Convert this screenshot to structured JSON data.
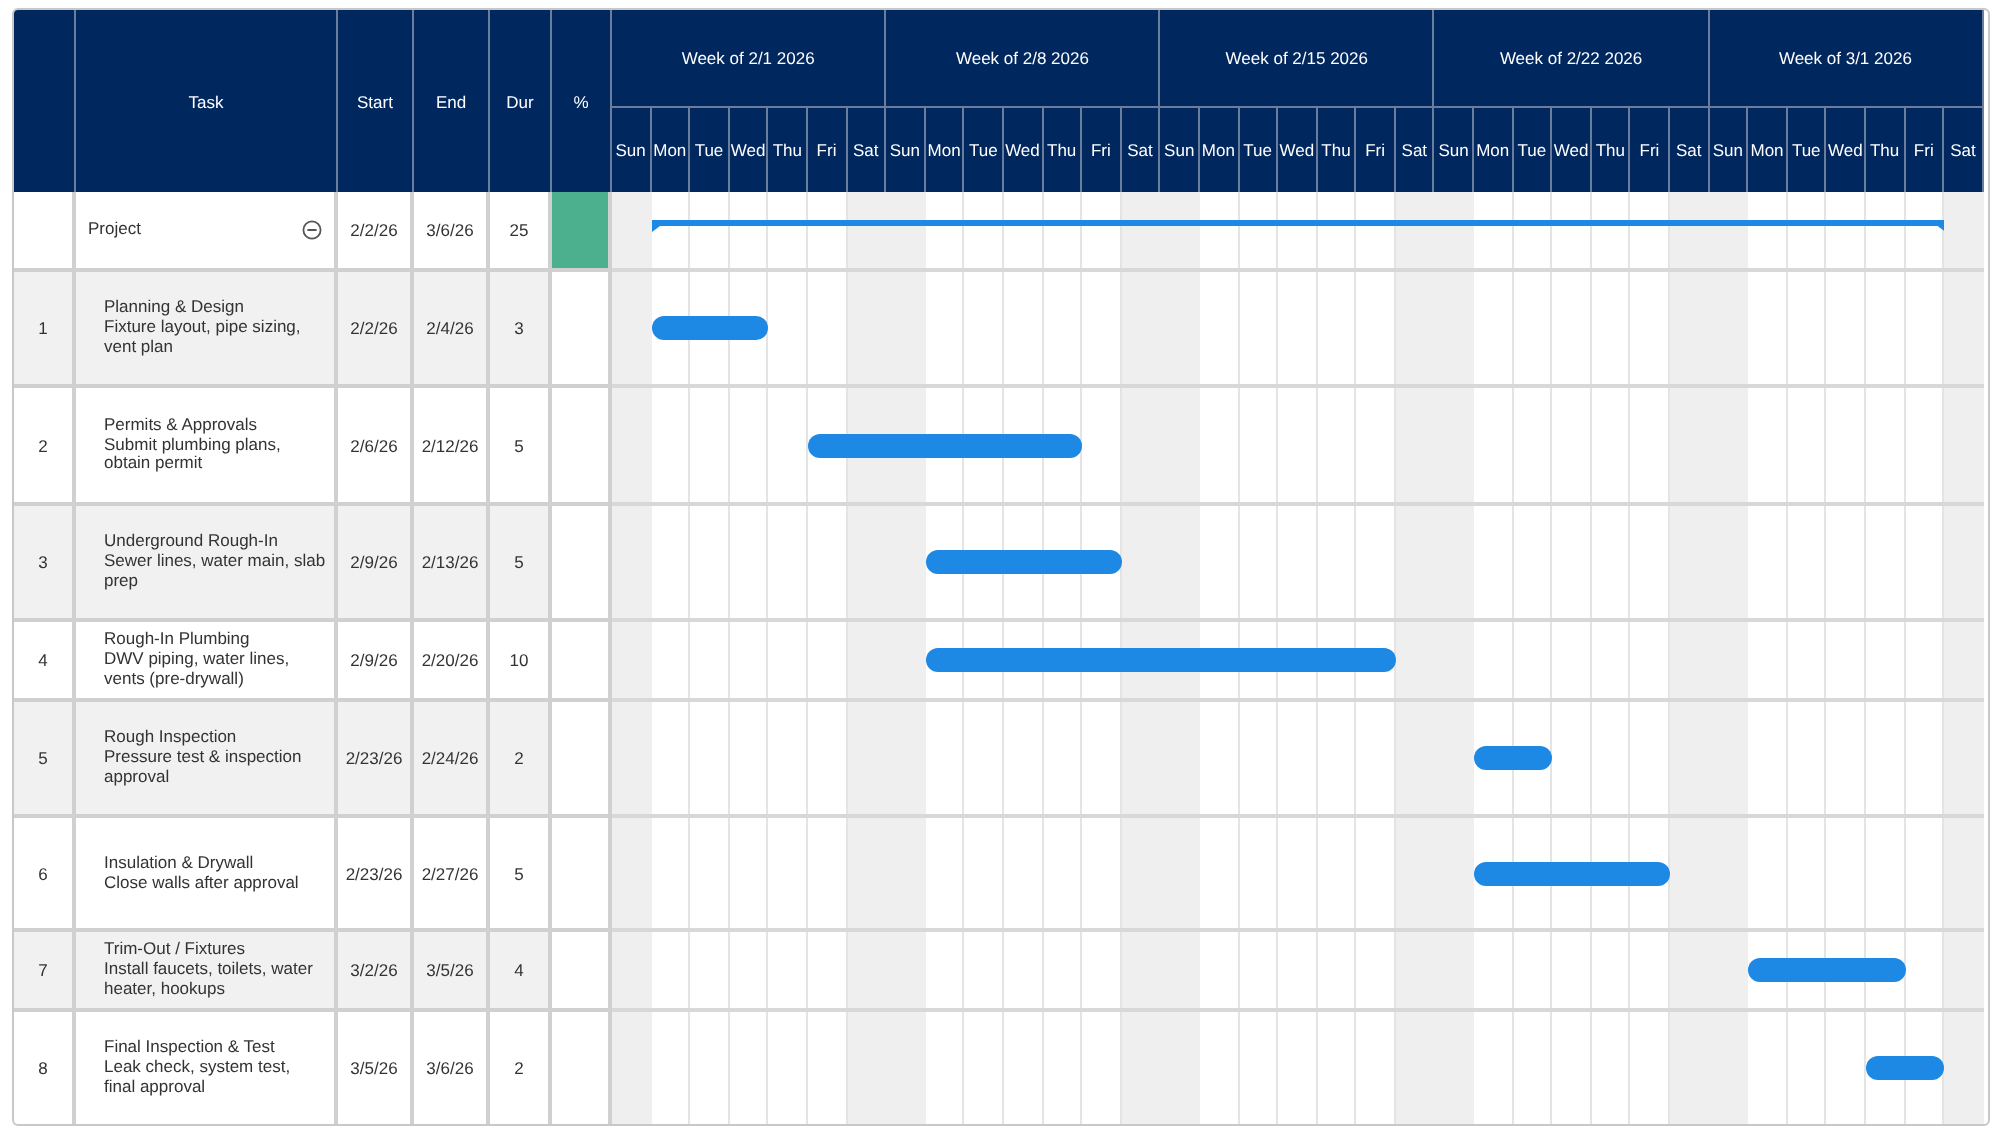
{
  "columns": {
    "task": "Task",
    "start": "Start",
    "end": "End",
    "duration": "Dur",
    "percent": "%"
  },
  "weeks": [
    {
      "label": "Week of 2/1 2026",
      "days": [
        "Sun",
        "Mon",
        "Tue",
        "Wed",
        "Thu",
        "Fri",
        "Sat"
      ]
    },
    {
      "label": "Week of 2/8 2026",
      "days": [
        "Sun",
        "Mon",
        "Tue",
        "Wed",
        "Thu",
        "Fri",
        "Sat"
      ]
    },
    {
      "label": "Week of 2/15 2026",
      "days": [
        "Sun",
        "Mon",
        "Tue",
        "Wed",
        "Thu",
        "Fri",
        "Sat"
      ]
    },
    {
      "label": "Week of 2/22 2026",
      "days": [
        "Sun",
        "Mon",
        "Tue",
        "Wed",
        "Thu",
        "Fri",
        "Sat"
      ]
    },
    {
      "label": "Week of 3/1 2026",
      "days": [
        "Sun",
        "Mon",
        "Tue",
        "Wed",
        "Thu",
        "Fri",
        "Sat"
      ]
    }
  ],
  "project": {
    "name": "Project",
    "expanded": true,
    "start": "2/2/26",
    "end": "3/6/26",
    "duration": "25",
    "percent_highlight": true,
    "children": [
      {
        "number": "1",
        "name": "Planning & Design",
        "description": "Fixture layout, pipe sizing, vent plan",
        "start": "2/2/26",
        "end": "2/4/26",
        "duration": "3",
        "percent_highlight": false
      },
      {
        "number": "2",
        "name": "Permits & Approvals",
        "description": "Submit plumbing plans, obtain permit",
        "start": "2/6/26",
        "end": "2/12/26",
        "duration": "5",
        "percent_highlight": false
      },
      {
        "number": "3",
        "name": "Underground Rough-In",
        "description": "Sewer lines, water main, slab prep",
        "start": "2/9/26",
        "end": "2/13/26",
        "duration": "5",
        "percent_highlight": false
      },
      {
        "number": "4",
        "name": "Rough-In Plumbing",
        "description": "DWV piping, water lines, vents (pre-drywall)",
        "start": "2/9/26",
        "end": "2/20/26",
        "duration": "10",
        "percent_highlight": false
      },
      {
        "number": "5",
        "name": "Rough Inspection",
        "description": "Pressure test & inspection approval",
        "start": "2/23/26",
        "end": "2/24/26",
        "duration": "2",
        "percent_highlight": false
      },
      {
        "number": "6",
        "name": "Insulation & Drywall",
        "description": "Close walls after approval",
        "start": "2/23/26",
        "end": "2/27/26",
        "duration": "5",
        "percent_highlight": false
      },
      {
        "number": "7",
        "name": "Trim-Out / Fixtures",
        "description": "Install faucets, toilets, water heater, hookups",
        "start": "3/2/26",
        "end": "3/5/26",
        "duration": "4",
        "percent_highlight": false
      },
      {
        "number": "8",
        "name": "Final Inspection & Test",
        "description": "Leak check, system test, final approval",
        "start": "3/5/26",
        "end": "3/6/26",
        "duration": "2",
        "percent_highlight": false
      }
    ]
  }
}
